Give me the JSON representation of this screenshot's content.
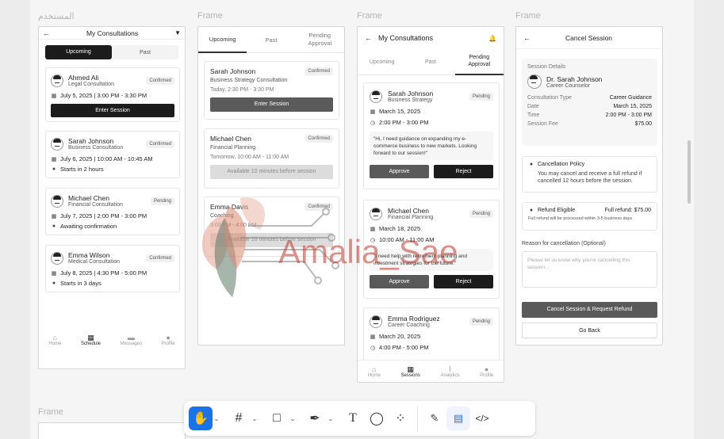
{
  "frame_labels": {
    "f1": "المستخدم",
    "f2": "Frame",
    "f3": "Frame",
    "f4": "Frame",
    "f5": "Frame"
  },
  "screen1": {
    "title": "My Consultations",
    "tabs": {
      "upcoming": "Upcoming",
      "past": "Past"
    },
    "cards": [
      {
        "name": "Ahmed Ali",
        "type": "Legal Consultation",
        "badge": "Confirmed",
        "datetime": "July 5, 2025 | 3:00 PM - 3:30 PM",
        "action": "Enter Session"
      },
      {
        "name": "Sarah Johnson",
        "type": "Business Consultation",
        "badge": "Confirmed",
        "datetime": "July 6, 2025 | 10:00 AM - 10:45 AM",
        "status": "Starts in 2 hours"
      },
      {
        "name": "Michael Chen",
        "type": "Financial Consultation",
        "badge": "Pending",
        "datetime": "July 7, 2025 | 2:00 PM - 3:00 PM",
        "status": "Awaiting confirmation"
      },
      {
        "name": "Emma Wilson",
        "type": "Medical Consultation",
        "badge": "Confirmed",
        "datetime": "July 8, 2025 | 4:30 PM - 5:00 PM",
        "status": "Starts in 3 days"
      }
    ],
    "nav": {
      "home": "Home",
      "schedule": "Schedule",
      "messages": "Messages",
      "profile": "Profile"
    }
  },
  "screen2": {
    "tabs": {
      "upcoming": "Upcoming",
      "past": "Past",
      "pending": "Pending\nApproval"
    },
    "cards": [
      {
        "name": "Sarah Johnson",
        "type": "Business Strategy Consultation",
        "badge": "Confirmed",
        "time": "Today, 2:30 PM - 3:30 PM",
        "action": "Enter Session"
      },
      {
        "name": "Michael Chen",
        "type": "Financial Planning",
        "badge": "Confirmed",
        "time": "Tomorrow, 10:00 AM - 11:00 AM",
        "action": "Available 10 minutes before session"
      },
      {
        "name": "Emma Davis",
        "type": "Coaching",
        "badge": "Confirmed",
        "time": "3:00 PM - 4:00 PM",
        "action": "Available 10 minutes before session"
      }
    ]
  },
  "screen3": {
    "title": "My Consultations",
    "tabs": {
      "upcoming": "Upcoming",
      "past": "Past",
      "pending": "Pending\nApproval"
    },
    "cards": [
      {
        "name": "Sarah Johnson",
        "type": "Business Strategy",
        "badge": "Pending",
        "date": "March 15, 2025",
        "time": "2:00 PM - 3:00 PM",
        "message": "\"Hi, I need guidance on expanding my e-commerce business to new markets. Looking forward to our session!\"",
        "approve": "Approve",
        "reject": "Reject"
      },
      {
        "name": "Michael Chen",
        "type": "Financial Planning",
        "badge": "Pending",
        "date": "March 18, 2025",
        "time": "10:00 AM - 11:00 AM",
        "message": "\"I need help with retirement planning and investment strategies for the future.\"",
        "approve": "Approve",
        "reject": "Reject"
      },
      {
        "name": "Emma Rodriguez",
        "type": "Career Coaching",
        "badge": "Pending",
        "date": "March 20, 2025",
        "time": "4:00 PM - 5:00 PM"
      }
    ],
    "nav": {
      "home": "Home",
      "sessions": "Sessions",
      "analytics": "Analytics",
      "profile": "Profile"
    }
  },
  "screen4": {
    "title": "Cancel Session",
    "details_heading": "Session Details",
    "doctor": "Dr. Sarah Johnson",
    "role": "Career Counselor",
    "fields": [
      {
        "label": "Consultation Type",
        "value": "Career Guidance"
      },
      {
        "label": "Date",
        "value": "March 15, 2025"
      },
      {
        "label": "Time",
        "value": "2:00 PM - 3:00 PM"
      },
      {
        "label": "Session Fee",
        "value": "$75.00"
      }
    ],
    "policy_title": "Cancellation Policy",
    "policy_text": "You may cancel and receive a full refund if cancelled 12 hours before the session.",
    "refund_label": "Refund Eligible",
    "refund_amount": "Full refund: $75.00",
    "refund_note": "Full refund will be processed within 3-5 business days",
    "reason_label": "Reason for cancellation (Optional)",
    "reason_placeholder": "Please let us know why you're cancelling this session...",
    "cancel_button": "Cancel Session & Request Refund",
    "back_button": "Go Back"
  },
  "watermark": "Amalia_Sae",
  "colors": {
    "accent": "#1a73e8",
    "dark_button": "#1c1c1c",
    "watermark": "#c0392b"
  },
  "toolbar_icons": [
    "hand-icon",
    "frame-icon",
    "rectangle-icon",
    "pen-icon",
    "text-icon",
    "comment-icon",
    "components-icon",
    "draw-icon",
    "dev-mode-icon",
    "code-icon"
  ]
}
